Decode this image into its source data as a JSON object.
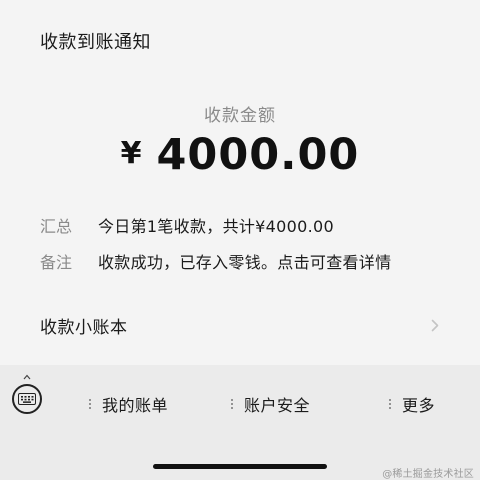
{
  "header": {
    "title": "收款到账通知"
  },
  "amount": {
    "label": "收款金额",
    "currency": "¥",
    "value": "4000.00"
  },
  "details": [
    {
      "key": "汇总",
      "value": "今日第1笔收款，共计¥4000.00"
    },
    {
      "key": "备注",
      "value": "收款成功，已存入零钱。点击可查看详情"
    }
  ],
  "ledger": {
    "label": "收款小账本",
    "icon": "chevron-right-icon"
  },
  "bottom_menu": {
    "keyboard_icon": "keyboard-icon",
    "items": [
      {
        "label": "我的账单"
      },
      {
        "label": "账户安全"
      },
      {
        "label": "更多"
      }
    ]
  },
  "watermark": "@稀土掘金技术社区",
  "colors": {
    "background": "#ebebeb",
    "card": "#f4f4f4",
    "text": "#1b1b1b",
    "muted": "#8a8a8a"
  }
}
